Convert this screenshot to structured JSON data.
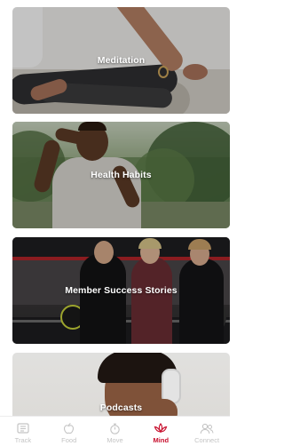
{
  "cards": [
    {
      "title": "Meditation"
    },
    {
      "title": "Health Habits"
    },
    {
      "title": "Member Success Stories"
    },
    {
      "title": "Podcasts"
    }
  ],
  "nav": {
    "items": [
      {
        "label": "Track",
        "icon": "list-icon",
        "active": false
      },
      {
        "label": "Food",
        "icon": "apple-icon",
        "active": false
      },
      {
        "label": "Move",
        "icon": "stopwatch-icon",
        "active": false
      },
      {
        "label": "Mind",
        "icon": "lotus-icon",
        "active": true
      },
      {
        "label": "Connect",
        "icon": "people-icon",
        "active": false
      }
    ],
    "active_color": "#c8102e",
    "inactive_color": "#c4c4c4"
  }
}
